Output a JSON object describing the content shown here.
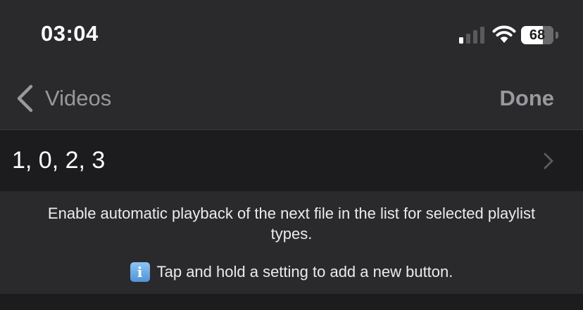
{
  "status_bar": {
    "time": "03:04",
    "battery_level": "68",
    "battery_percent": 68,
    "icons": [
      "signal-icon",
      "wifi-icon",
      "battery-icon"
    ]
  },
  "nav": {
    "back_label": "Videos",
    "done_label": "Done",
    "icons": [
      "chevron-left-icon"
    ]
  },
  "row": {
    "value": "1, 0, 2, 3",
    "icons": [
      "chevron-right-icon"
    ]
  },
  "footer": {
    "description": "Enable automatic playback of the next file in the list for selected playlist types.",
    "info_glyph": "i",
    "tip": "Tap and hold a setting to add a new button."
  },
  "colors": {
    "background": "#2a2a2c",
    "row_background": "#1c1c1e",
    "nav_text": "#98989d",
    "info_blue": "#4f93d8"
  }
}
